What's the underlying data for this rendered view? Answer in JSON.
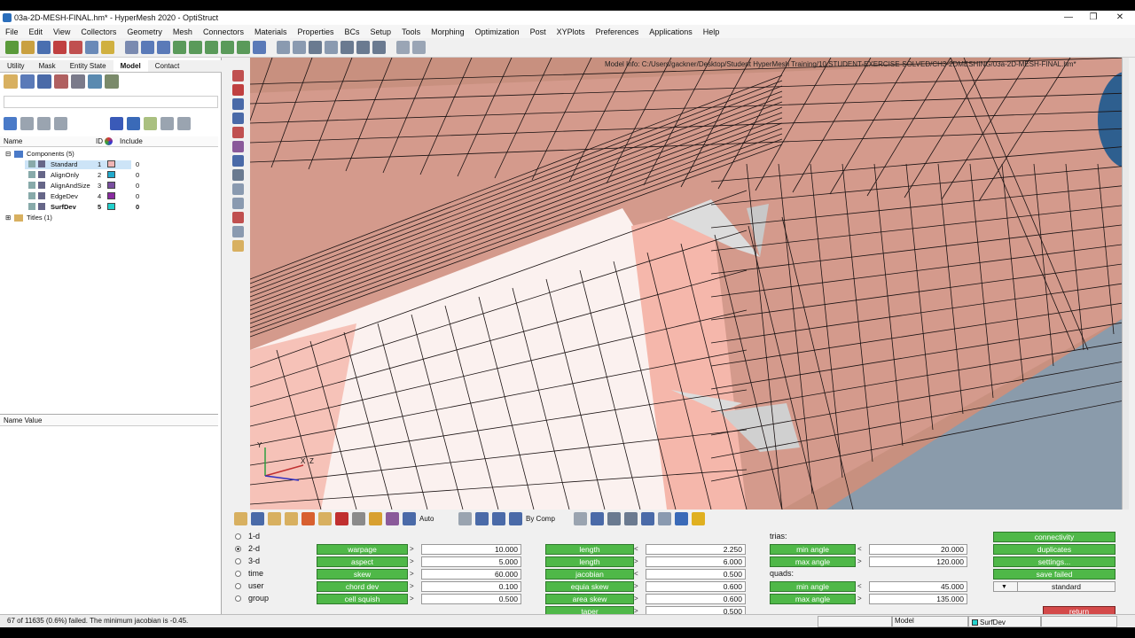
{
  "window": {
    "title": "03a-2D-MESH-FINAL.hm* - HyperMesh 2020 - OptiStruct",
    "min": "—",
    "max": "❐",
    "close": "✕"
  },
  "menu": [
    "File",
    "Edit",
    "View",
    "Collectors",
    "Geometry",
    "Mesh",
    "Connectors",
    "Materials",
    "Properties",
    "BCs",
    "Setup",
    "Tools",
    "Morphing",
    "Optimization",
    "Post",
    "XYPlots",
    "Preferences",
    "Applications",
    "Help"
  ],
  "browser": {
    "tabs": [
      "Utility",
      "Mask",
      "Entity State",
      "Model",
      "Contact"
    ],
    "active_tab": "Model",
    "columns": {
      "name": "Name",
      "id": "ID",
      "include": "Include"
    },
    "components_label": "Components (5)",
    "components": [
      {
        "name": "Standard",
        "id": "1",
        "color": "#f0b4b4",
        "include": "0",
        "selected": true,
        "bold": false
      },
      {
        "name": "AlignOnly",
        "id": "2",
        "color": "#22aacc",
        "include": "0",
        "selected": false,
        "bold": false
      },
      {
        "name": "AlignAndSize",
        "id": "3",
        "color": "#7a4fa0",
        "include": "0",
        "selected": false,
        "bold": false
      },
      {
        "name": "EdgeDev",
        "id": "4",
        "color": "#8a2aa0",
        "include": "0",
        "selected": false,
        "bold": false
      },
      {
        "name": "SurfDev",
        "id": "5",
        "color": "#22d0cc",
        "include": "0",
        "selected": false,
        "bold": true
      }
    ],
    "titles_label": "Titles (1)",
    "name_value_header": "Name Value"
  },
  "viewport": {
    "model_info": "Model Info: C:/Users/gackner/Desktop/Student HyperMesh Training/10.STUDENT-EXERCISE-SOLVED/CH3-2DMESHING/03a-2D-MESH-FINAL.hm*",
    "axis": {
      "y": "Y",
      "z": "Z",
      "x": "X"
    }
  },
  "bottom_toolbar": {
    "auto_label": "Auto",
    "bycomp_label": "By Comp"
  },
  "quality_panel": {
    "modes": [
      {
        "label": "1-d",
        "selected": false
      },
      {
        "label": "2-d",
        "selected": true
      },
      {
        "label": "3-d",
        "selected": false
      },
      {
        "label": "time",
        "selected": false
      },
      {
        "label": "user",
        "selected": false
      },
      {
        "label": "group",
        "selected": false
      }
    ],
    "col1": [
      {
        "label": "warpage",
        "op": ">",
        "value": "10.000"
      },
      {
        "label": "aspect",
        "op": ">",
        "value": "5.000"
      },
      {
        "label": "skew",
        "op": ">",
        "value": "60.000"
      },
      {
        "label": "chord dev",
        "op": ">",
        "value": "0.100"
      },
      {
        "label": "cell squish",
        "op": ">",
        "value": "0.500"
      }
    ],
    "col2": [
      {
        "label": "length",
        "op": "<",
        "value": "2.250"
      },
      {
        "label": "length",
        "op": ">",
        "value": "6.000"
      },
      {
        "label": "jacobian",
        "op": "<",
        "value": "0.500"
      },
      {
        "label": "equia skew",
        "op": ">",
        "value": "0.600"
      },
      {
        "label": "area skew",
        "op": ">",
        "value": "0.600"
      },
      {
        "label": "taper",
        "op": ">",
        "value": "0.500"
      }
    ],
    "trias_label": "trias:",
    "trias": [
      {
        "label": "min angle",
        "op": "<",
        "value": "20.000"
      },
      {
        "label": "max angle",
        "op": ">",
        "value": "120.000"
      }
    ],
    "quads_label": "quads:",
    "quads": [
      {
        "label": "min angle",
        "op": "<",
        "value": "45.000"
      },
      {
        "label": "max angle",
        "op": ">",
        "value": "135.000"
      }
    ],
    "right_buttons": [
      "connectivity",
      "duplicates",
      "settings...",
      "save failed"
    ],
    "standard_label": "standard",
    "return_label": "return"
  },
  "status": {
    "message": "67 of 11635 (0.6%) failed.  The minimum jacobian is -0.45.",
    "mode": "Model",
    "component": "SurfDev"
  },
  "colors": {
    "green": "#4fb848",
    "return": "#d44a4a",
    "mesh_pink": "#d49a8c",
    "mesh_white": "#fbf1ef",
    "viewport_bg": "#8a9bab"
  }
}
